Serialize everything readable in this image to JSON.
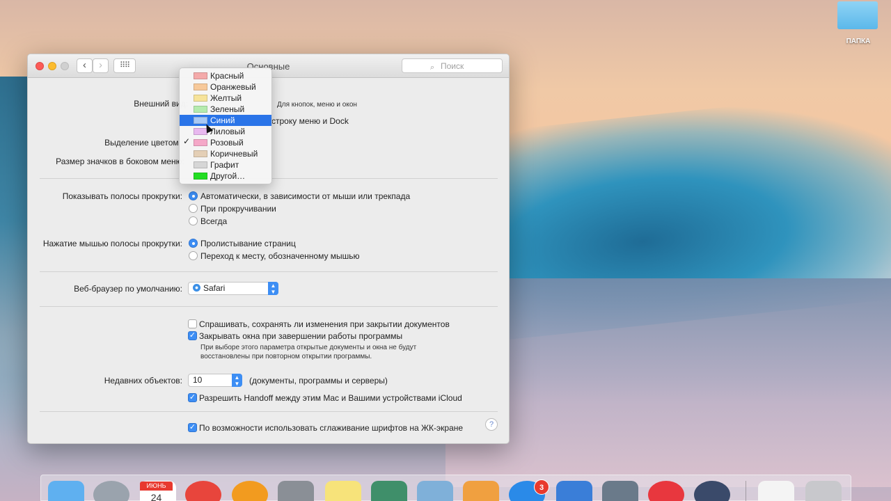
{
  "desktop": {
    "folder_label": "ПАПКА"
  },
  "window": {
    "title": "Основные",
    "search_placeholder": "Поиск"
  },
  "appearance": {
    "label": "Внешний вид:",
    "hint": "Для кнопок, меню и окон",
    "dark_menu_option": "строку меню и Dock"
  },
  "highlight": {
    "label": "Выделение цветом:"
  },
  "sidebar_icon_size": {
    "label": "Размер значков в боковом меню:"
  },
  "color_menu": {
    "selected": "Синий",
    "items": [
      {
        "label": "Красный",
        "color": "#f4aaaa"
      },
      {
        "label": "Оранжевый",
        "color": "#f7c99a"
      },
      {
        "label": "Желтый",
        "color": "#f6e39a"
      },
      {
        "label": "Зеленый",
        "color": "#b5ebae"
      },
      {
        "label": "Синий",
        "color": "#a8c8f4"
      },
      {
        "label": "Лиловый",
        "color": "#e8b8ef"
      },
      {
        "label": "Розовый",
        "color": "#f5a8c8"
      },
      {
        "label": "Коричневый",
        "color": "#e4cfb6"
      },
      {
        "label": "Графит",
        "color": "#d6d6d6"
      },
      {
        "label": "Другой…",
        "color": "#22dd22"
      }
    ],
    "checked_item": "Розовый"
  },
  "scrollbars": {
    "label": "Показывать полосы прокрутки:",
    "options": [
      "Автоматически, в зависимости от мыши или трекпада",
      "При прокручивании",
      "Всегда"
    ],
    "selected_index": 0
  },
  "scroll_click": {
    "label": "Нажатие мышью полосы прокрутки:",
    "options": [
      "Пролистывание страниц",
      "Переход к месту, обозначенному мышью"
    ],
    "selected_index": 0
  },
  "browser": {
    "label": "Веб-браузер по умолчанию:",
    "value": "Safari"
  },
  "documents": {
    "ask_save": "Спрашивать, сохранять ли изменения при закрытии документов",
    "ask_save_checked": false,
    "close_windows": "Закрывать окна при завершении работы программы",
    "close_windows_checked": true,
    "close_windows_note_1": "При выборе этого параметра открытые документы и окна не будут",
    "close_windows_note_2": "восстановлены при повторном открытии программы."
  },
  "recent": {
    "label": "Недавних объектов:",
    "value": "10",
    "hint": "(документы, программы и серверы)"
  },
  "handoff": {
    "label": "Разрешить Handoff между этим Mac и Вашими устройствами iCloud",
    "checked": true
  },
  "font_smoothing": {
    "label": "По возможности использовать сглаживание шрифтов на ЖК-экране",
    "checked": true
  },
  "help": {
    "glyph": "?"
  },
  "dock": {
    "calendar_month": "ИЮНЬ",
    "calendar_day": "24",
    "app_store_badge": "3",
    "items": [
      {
        "name": "finder-icon",
        "color": "#5fb0f0"
      },
      {
        "name": "launchpad-icon",
        "color": "#9aa3ad"
      },
      {
        "name": "calendar-icon",
        "color": "#ffffff"
      },
      {
        "name": "chrome-icon",
        "color": "#e8453c"
      },
      {
        "name": "ibooks-icon",
        "color": "#f29b1f"
      },
      {
        "name": "system-preferences-icon",
        "color": "#8a8f96"
      },
      {
        "name": "notes-icon",
        "color": "#f7e37a"
      },
      {
        "name": "photos-icon",
        "color": "#3f8f6a"
      },
      {
        "name": "preview-icon",
        "color": "#7fb0d9"
      },
      {
        "name": "pages-icon",
        "color": "#f0a040"
      },
      {
        "name": "app-store-icon",
        "color": "#2a8ae8"
      },
      {
        "name": "keynote-icon",
        "color": "#3a7ed8"
      },
      {
        "name": "image-capture-icon",
        "color": "#6a7a8a"
      },
      {
        "name": "itunes-icon",
        "color": "#e8373e"
      },
      {
        "name": "quicktime-icon",
        "color": "#3a4a6a"
      },
      {
        "name": "document-icon",
        "color": "#f4f4f4"
      },
      {
        "name": "trash-icon",
        "color": "#c8c8cc"
      }
    ]
  }
}
